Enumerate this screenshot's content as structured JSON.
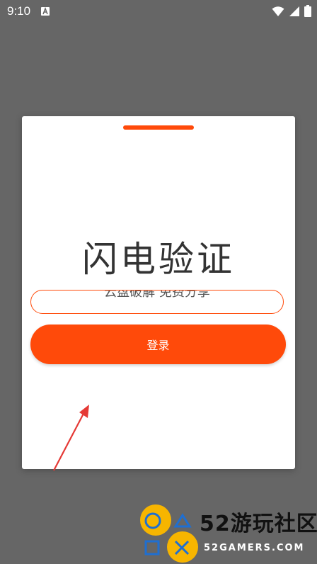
{
  "status_bar": {
    "time": "9:10",
    "icons": [
      "notification-a-icon",
      "wifi-icon",
      "signal-icon",
      "battery-icon"
    ]
  },
  "dialog": {
    "title": "闪电验证",
    "input_text": "云盘破解 免费分享",
    "login_label": "登录"
  },
  "watermark": {
    "title": "52游玩社区",
    "subtitle": "52GAMERS.COM"
  },
  "colors": {
    "accent": "#ff4a0a",
    "overlay": "#666666",
    "dialog_bg": "#ffffff",
    "annotation_arrow": "#e53935",
    "watermark_yellow": "#f7b500",
    "watermark_blue": "#1f6fd1"
  }
}
